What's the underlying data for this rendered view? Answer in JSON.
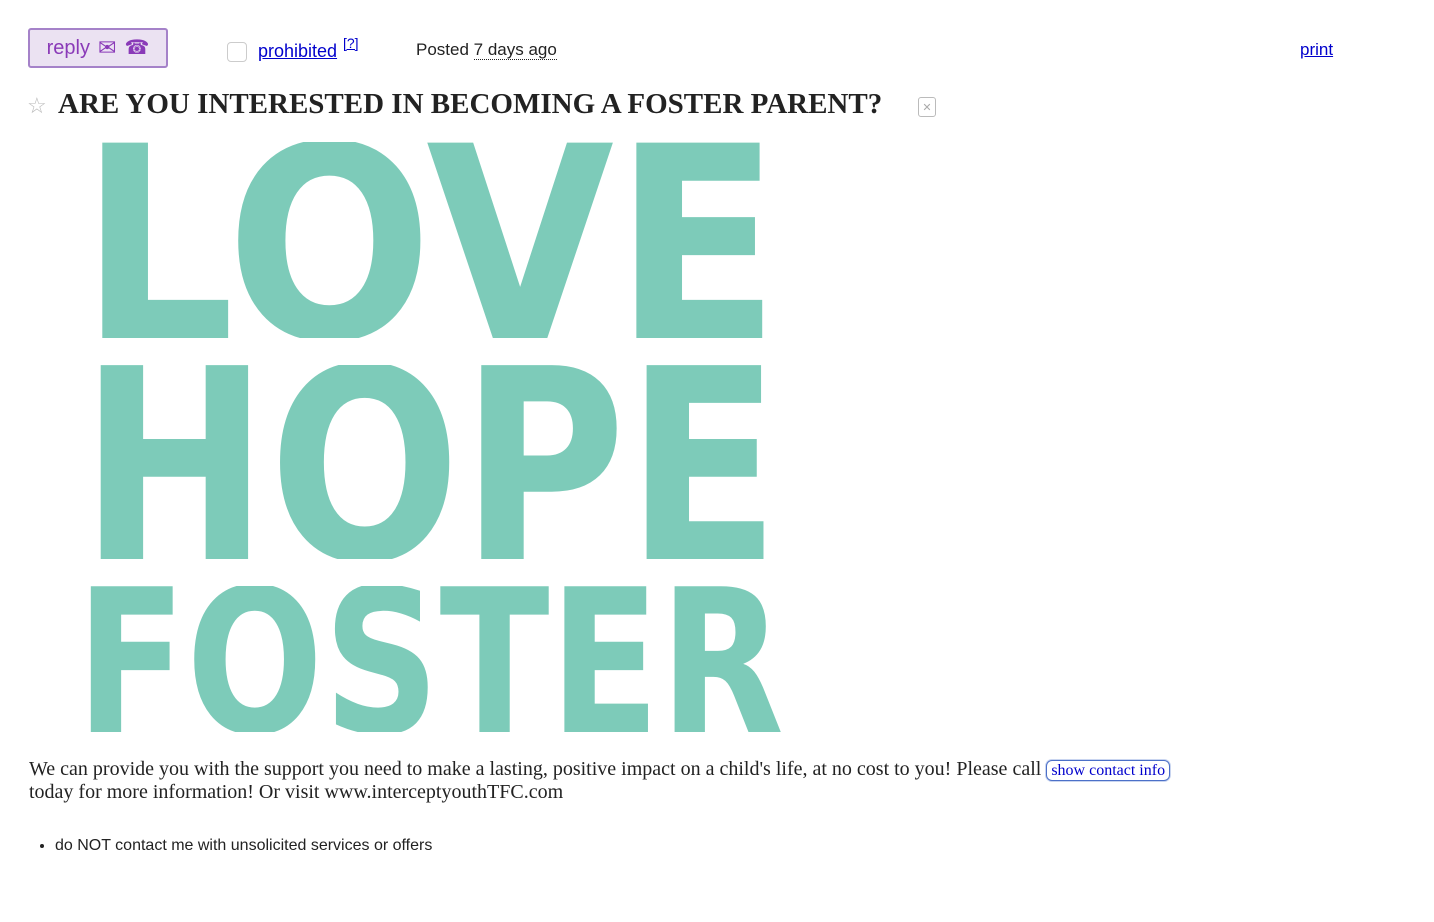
{
  "header": {
    "reply_label": "reply",
    "reply_icons": [
      "envelope-icon",
      "phone-icon"
    ],
    "prohibited_label": "prohibited",
    "help_label": "[?]",
    "posted_prefix": "Posted",
    "posted_ago": "7 days ago",
    "print_label": "print"
  },
  "post": {
    "title": "ARE YOU INTERESTED IN BECOMING A FOSTER PARENT?",
    "image_words": [
      "LOVE",
      "HOPE",
      "FOSTER"
    ],
    "body_part1": "We can provide you with the support you need to make a lasting, positive impact on a child's life, at no cost to you! Please call",
    "contact_button": "show contact info",
    "body_part2": "today for more information! Or visit www.interceptyouthTFC.com",
    "notices": [
      "do NOT contact me with unsolicited services or offers"
    ]
  },
  "colors": {
    "accent_purple": "#8a3ab8",
    "reply_bg": "#ebe2f2",
    "link_blue": "#0000cc",
    "poster_teal": "#7dcbb9"
  }
}
